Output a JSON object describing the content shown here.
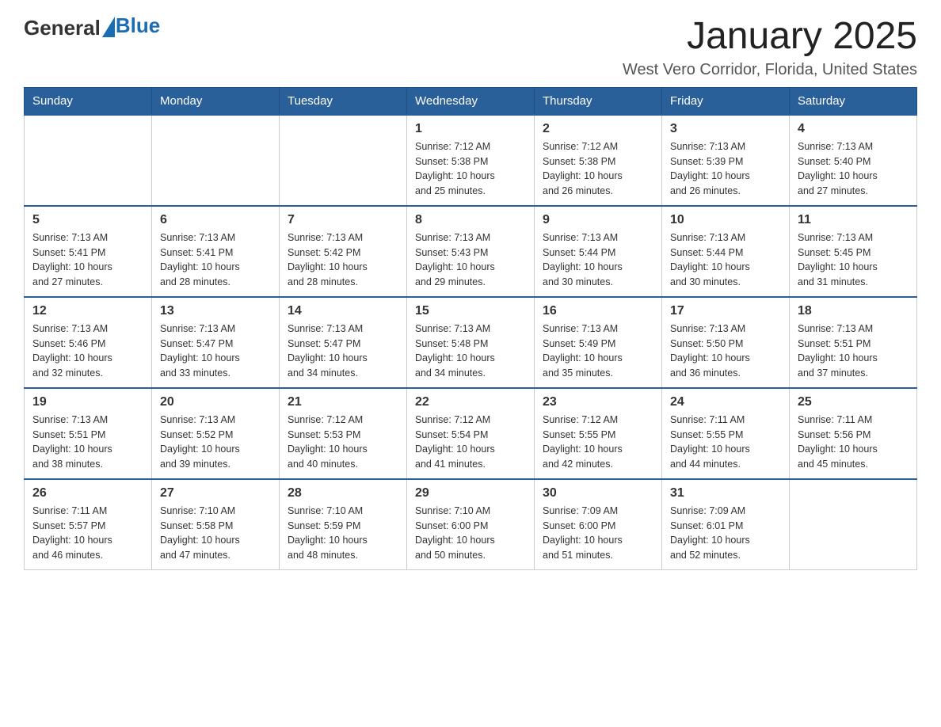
{
  "header": {
    "logo": {
      "general": "General",
      "blue": "Blue",
      "triangle_color": "#1a6db5"
    },
    "title": "January 2025",
    "location": "West Vero Corridor, Florida, United States"
  },
  "days_of_week": [
    "Sunday",
    "Monday",
    "Tuesday",
    "Wednesday",
    "Thursday",
    "Friday",
    "Saturday"
  ],
  "weeks": [
    [
      {
        "day": "",
        "info": ""
      },
      {
        "day": "",
        "info": ""
      },
      {
        "day": "",
        "info": ""
      },
      {
        "day": "1",
        "info": "Sunrise: 7:12 AM\nSunset: 5:38 PM\nDaylight: 10 hours\nand 25 minutes."
      },
      {
        "day": "2",
        "info": "Sunrise: 7:12 AM\nSunset: 5:38 PM\nDaylight: 10 hours\nand 26 minutes."
      },
      {
        "day": "3",
        "info": "Sunrise: 7:13 AM\nSunset: 5:39 PM\nDaylight: 10 hours\nand 26 minutes."
      },
      {
        "day": "4",
        "info": "Sunrise: 7:13 AM\nSunset: 5:40 PM\nDaylight: 10 hours\nand 27 minutes."
      }
    ],
    [
      {
        "day": "5",
        "info": "Sunrise: 7:13 AM\nSunset: 5:41 PM\nDaylight: 10 hours\nand 27 minutes."
      },
      {
        "day": "6",
        "info": "Sunrise: 7:13 AM\nSunset: 5:41 PM\nDaylight: 10 hours\nand 28 minutes."
      },
      {
        "day": "7",
        "info": "Sunrise: 7:13 AM\nSunset: 5:42 PM\nDaylight: 10 hours\nand 28 minutes."
      },
      {
        "day": "8",
        "info": "Sunrise: 7:13 AM\nSunset: 5:43 PM\nDaylight: 10 hours\nand 29 minutes."
      },
      {
        "day": "9",
        "info": "Sunrise: 7:13 AM\nSunset: 5:44 PM\nDaylight: 10 hours\nand 30 minutes."
      },
      {
        "day": "10",
        "info": "Sunrise: 7:13 AM\nSunset: 5:44 PM\nDaylight: 10 hours\nand 30 minutes."
      },
      {
        "day": "11",
        "info": "Sunrise: 7:13 AM\nSunset: 5:45 PM\nDaylight: 10 hours\nand 31 minutes."
      }
    ],
    [
      {
        "day": "12",
        "info": "Sunrise: 7:13 AM\nSunset: 5:46 PM\nDaylight: 10 hours\nand 32 minutes."
      },
      {
        "day": "13",
        "info": "Sunrise: 7:13 AM\nSunset: 5:47 PM\nDaylight: 10 hours\nand 33 minutes."
      },
      {
        "day": "14",
        "info": "Sunrise: 7:13 AM\nSunset: 5:47 PM\nDaylight: 10 hours\nand 34 minutes."
      },
      {
        "day": "15",
        "info": "Sunrise: 7:13 AM\nSunset: 5:48 PM\nDaylight: 10 hours\nand 34 minutes."
      },
      {
        "day": "16",
        "info": "Sunrise: 7:13 AM\nSunset: 5:49 PM\nDaylight: 10 hours\nand 35 minutes."
      },
      {
        "day": "17",
        "info": "Sunrise: 7:13 AM\nSunset: 5:50 PM\nDaylight: 10 hours\nand 36 minutes."
      },
      {
        "day": "18",
        "info": "Sunrise: 7:13 AM\nSunset: 5:51 PM\nDaylight: 10 hours\nand 37 minutes."
      }
    ],
    [
      {
        "day": "19",
        "info": "Sunrise: 7:13 AM\nSunset: 5:51 PM\nDaylight: 10 hours\nand 38 minutes."
      },
      {
        "day": "20",
        "info": "Sunrise: 7:13 AM\nSunset: 5:52 PM\nDaylight: 10 hours\nand 39 minutes."
      },
      {
        "day": "21",
        "info": "Sunrise: 7:12 AM\nSunset: 5:53 PM\nDaylight: 10 hours\nand 40 minutes."
      },
      {
        "day": "22",
        "info": "Sunrise: 7:12 AM\nSunset: 5:54 PM\nDaylight: 10 hours\nand 41 minutes."
      },
      {
        "day": "23",
        "info": "Sunrise: 7:12 AM\nSunset: 5:55 PM\nDaylight: 10 hours\nand 42 minutes."
      },
      {
        "day": "24",
        "info": "Sunrise: 7:11 AM\nSunset: 5:55 PM\nDaylight: 10 hours\nand 44 minutes."
      },
      {
        "day": "25",
        "info": "Sunrise: 7:11 AM\nSunset: 5:56 PM\nDaylight: 10 hours\nand 45 minutes."
      }
    ],
    [
      {
        "day": "26",
        "info": "Sunrise: 7:11 AM\nSunset: 5:57 PM\nDaylight: 10 hours\nand 46 minutes."
      },
      {
        "day": "27",
        "info": "Sunrise: 7:10 AM\nSunset: 5:58 PM\nDaylight: 10 hours\nand 47 minutes."
      },
      {
        "day": "28",
        "info": "Sunrise: 7:10 AM\nSunset: 5:59 PM\nDaylight: 10 hours\nand 48 minutes."
      },
      {
        "day": "29",
        "info": "Sunrise: 7:10 AM\nSunset: 6:00 PM\nDaylight: 10 hours\nand 50 minutes."
      },
      {
        "day": "30",
        "info": "Sunrise: 7:09 AM\nSunset: 6:00 PM\nDaylight: 10 hours\nand 51 minutes."
      },
      {
        "day": "31",
        "info": "Sunrise: 7:09 AM\nSunset: 6:01 PM\nDaylight: 10 hours\nand 52 minutes."
      },
      {
        "day": "",
        "info": ""
      }
    ]
  ]
}
